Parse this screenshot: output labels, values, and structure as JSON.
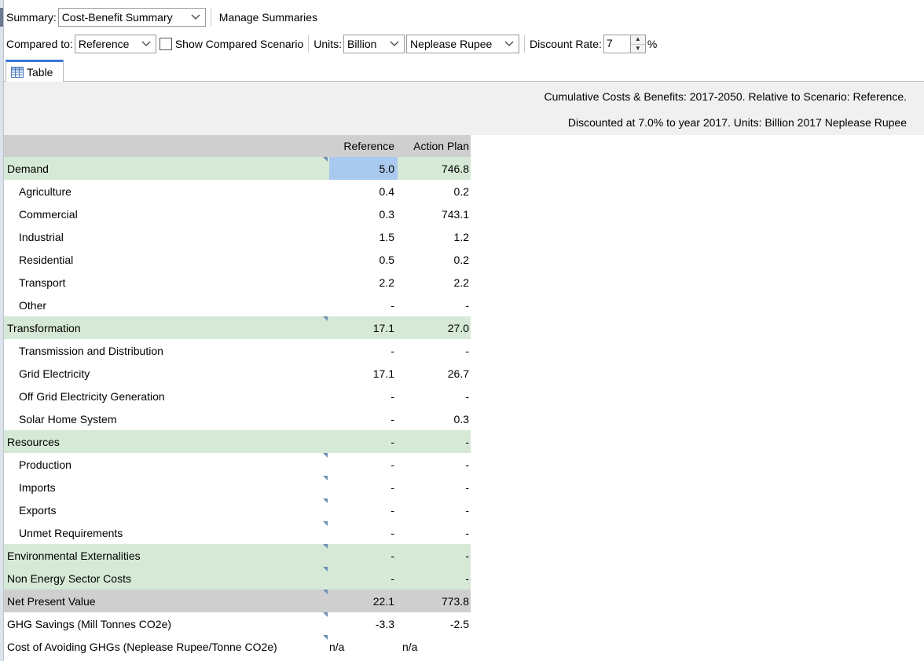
{
  "toolbar": {
    "summary_label": "Summary:",
    "summary_value": "Cost-Benefit Summary",
    "manage_label": "Manage Summaries",
    "compared_label": "Compared to:",
    "compared_value": "Reference",
    "show_compared_label": "Show Compared Scenario",
    "units_label": "Units:",
    "units_scale": "Billion",
    "currency": "Neplease Rupee",
    "discount_label": "Discount Rate:",
    "discount_value": "7",
    "percent": "%"
  },
  "tabs": [
    {
      "label": "Table",
      "icon": "table-grid-icon"
    }
  ],
  "report": {
    "header_line1": "Cumulative Costs & Benefits: 2017-2050. Relative to Scenario: Reference.",
    "header_line2": "Discounted at 7.0% to year 2017.  Units: Billion 2017 Neplease Rupee",
    "columns": [
      "Reference",
      "Action Plan"
    ],
    "rows": [
      {
        "name": "Demand",
        "ref": "5.0",
        "act": "746.8"
      },
      {
        "name": "Agriculture",
        "ref": "0.4",
        "act": "0.2"
      },
      {
        "name": "Commercial",
        "ref": "0.3",
        "act": "743.1"
      },
      {
        "name": "Industrial",
        "ref": "1.5",
        "act": "1.2"
      },
      {
        "name": "Residential",
        "ref": "0.5",
        "act": "0.2"
      },
      {
        "name": "Transport",
        "ref": "2.2",
        "act": "2.2"
      },
      {
        "name": "Other",
        "ref": "-",
        "act": "-"
      },
      {
        "name": "Transformation",
        "ref": "17.1",
        "act": "27.0"
      },
      {
        "name": "Transmission and Distribution",
        "ref": "-",
        "act": "-"
      },
      {
        "name": "Grid Electricity",
        "ref": "17.1",
        "act": "26.7"
      },
      {
        "name": "Off Grid Electricity Generation",
        "ref": "-",
        "act": "-"
      },
      {
        "name": "Solar Home System",
        "ref": "-",
        "act": "0.3"
      },
      {
        "name": "Resources",
        "ref": "-",
        "act": "-"
      },
      {
        "name": "Production",
        "ref": "-",
        "act": "-"
      },
      {
        "name": "Imports",
        "ref": "-",
        "act": "-"
      },
      {
        "name": "Exports",
        "ref": "-",
        "act": "-"
      },
      {
        "name": "Unmet Requirements",
        "ref": "-",
        "act": "-"
      },
      {
        "name": "Environmental Externalities",
        "ref": "-",
        "act": "-"
      },
      {
        "name": "Non Energy Sector Costs",
        "ref": "-",
        "act": "-"
      },
      {
        "name": "Net Present Value",
        "ref": "22.1",
        "act": "773.8"
      },
      {
        "name": "GHG Savings (Mill Tonnes CO2e)",
        "ref": "-3.3",
        "act": "-2.5"
      },
      {
        "name": "Cost of Avoiding GHGs (Neplease Rupee/Tonne CO2e)",
        "ref": "n/a",
        "act": "n/a"
      }
    ]
  },
  "colors": {
    "group_row": "#d6e9d6",
    "header_row": "#cfcfcf",
    "selected_cell": "#a9c9ee",
    "tab_accent": "#3b78d4"
  }
}
